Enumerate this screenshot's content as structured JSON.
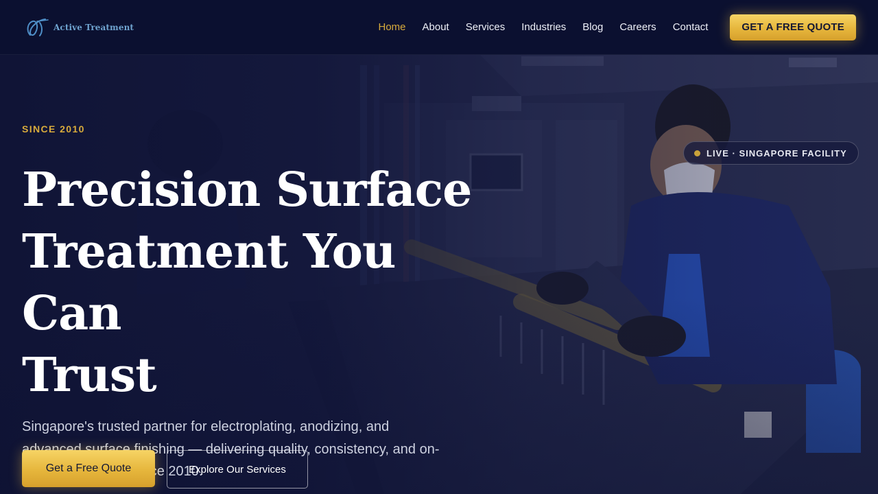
{
  "brand": {
    "name": "Active Treatment",
    "logo_icon": "active-treatment-logo-icon"
  },
  "nav": {
    "items": [
      {
        "label": "Home",
        "active": true
      },
      {
        "label": "About",
        "active": false
      },
      {
        "label": "Services",
        "active": false
      },
      {
        "label": "Industries",
        "active": false
      },
      {
        "label": "Blog",
        "active": false
      },
      {
        "label": "Careers",
        "active": false
      },
      {
        "label": "Contact",
        "active": false
      }
    ],
    "cta_label": "GET A FREE QUOTE"
  },
  "hero": {
    "eyebrow": "SINCE 2010",
    "title_lines": [
      "Precision Surface",
      "Treatment You Can",
      "Trust"
    ],
    "subtitle_lines": [
      "Singapore's trusted partner for electroplating, anodizing, and",
      "advanced surface finishing — delivering quality, consistency, and on-",
      "time performance since 2010."
    ],
    "primary_button": "Get a Free Quote",
    "secondary_button": "Explore Our Services"
  },
  "live_badge": {
    "text": "LIVE · SINGAPORE FACILITY",
    "dot_icon": "live-status-dot-icon"
  },
  "colors": {
    "navbar_bg": "#0b1030",
    "hero_overlay": "#10143a",
    "accent_gold": "#d8ab3c",
    "button_gold": "#f0c34a",
    "text_muted": "#cdd1e0"
  }
}
